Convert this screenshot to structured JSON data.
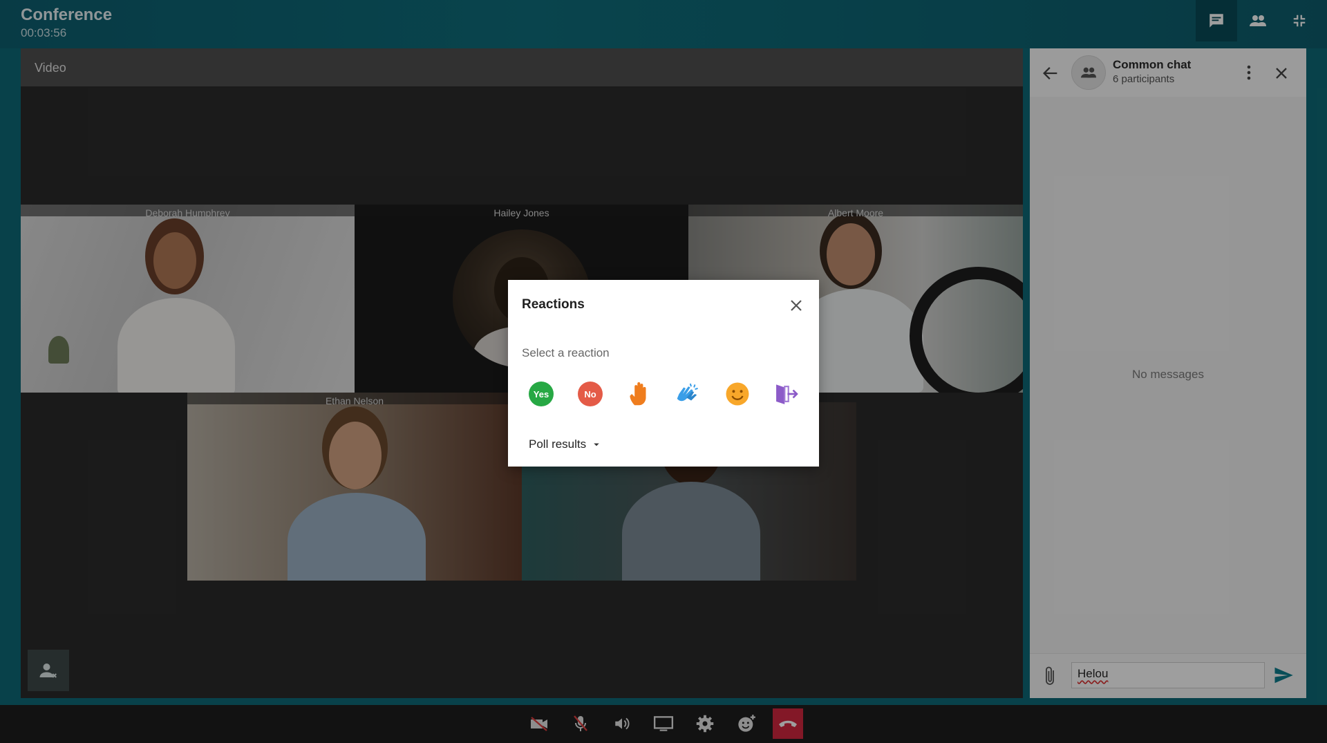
{
  "header": {
    "title": "Conference",
    "elapsed": "00:03:56"
  },
  "video": {
    "label": "Video",
    "participants": [
      "Deborah Humphrey",
      "Hailey Jones",
      "Albert Moore",
      "Ethan Nelson"
    ]
  },
  "chat": {
    "title": "Common chat",
    "subtitle": "6 participants",
    "empty_text": "No messages",
    "input_value": "Helou"
  },
  "reactions": {
    "title": "Reactions",
    "subtitle": "Select a reaction",
    "yes_label": "Yes",
    "no_label": "No",
    "poll_label": "Poll results"
  },
  "colors": {
    "accent": "#0e6a78",
    "yes": "#27a844",
    "no": "#e45b47",
    "hangup": "#d3283f"
  },
  "icons": [
    "chat-icon",
    "participants-icon",
    "collapse-icon",
    "back-arrow-icon",
    "more-vert-icon",
    "close-icon",
    "attach-icon",
    "send-icon",
    "camera-off-icon",
    "mic-off-icon",
    "speaker-icon",
    "screen-share-icon",
    "settings-icon",
    "reaction-icon",
    "hangup-icon"
  ]
}
